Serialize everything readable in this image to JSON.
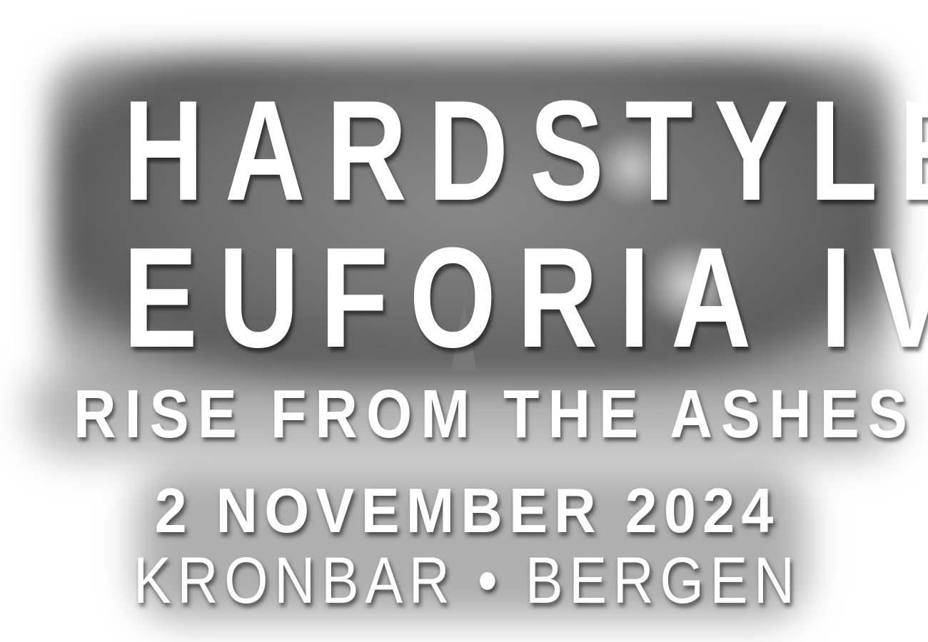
{
  "poster": {
    "title_line1": "HARDSTYLE",
    "title_line2": "EUFORIA IV",
    "subtitle": "RISE FROM THE ASHES",
    "date": "2 NOVEMBER 2024",
    "venue": "KRONBAR • BERGEN"
  },
  "colors": {
    "text": "#ffffff",
    "background": "#ffffff",
    "smoke": "#6f6f6f"
  }
}
